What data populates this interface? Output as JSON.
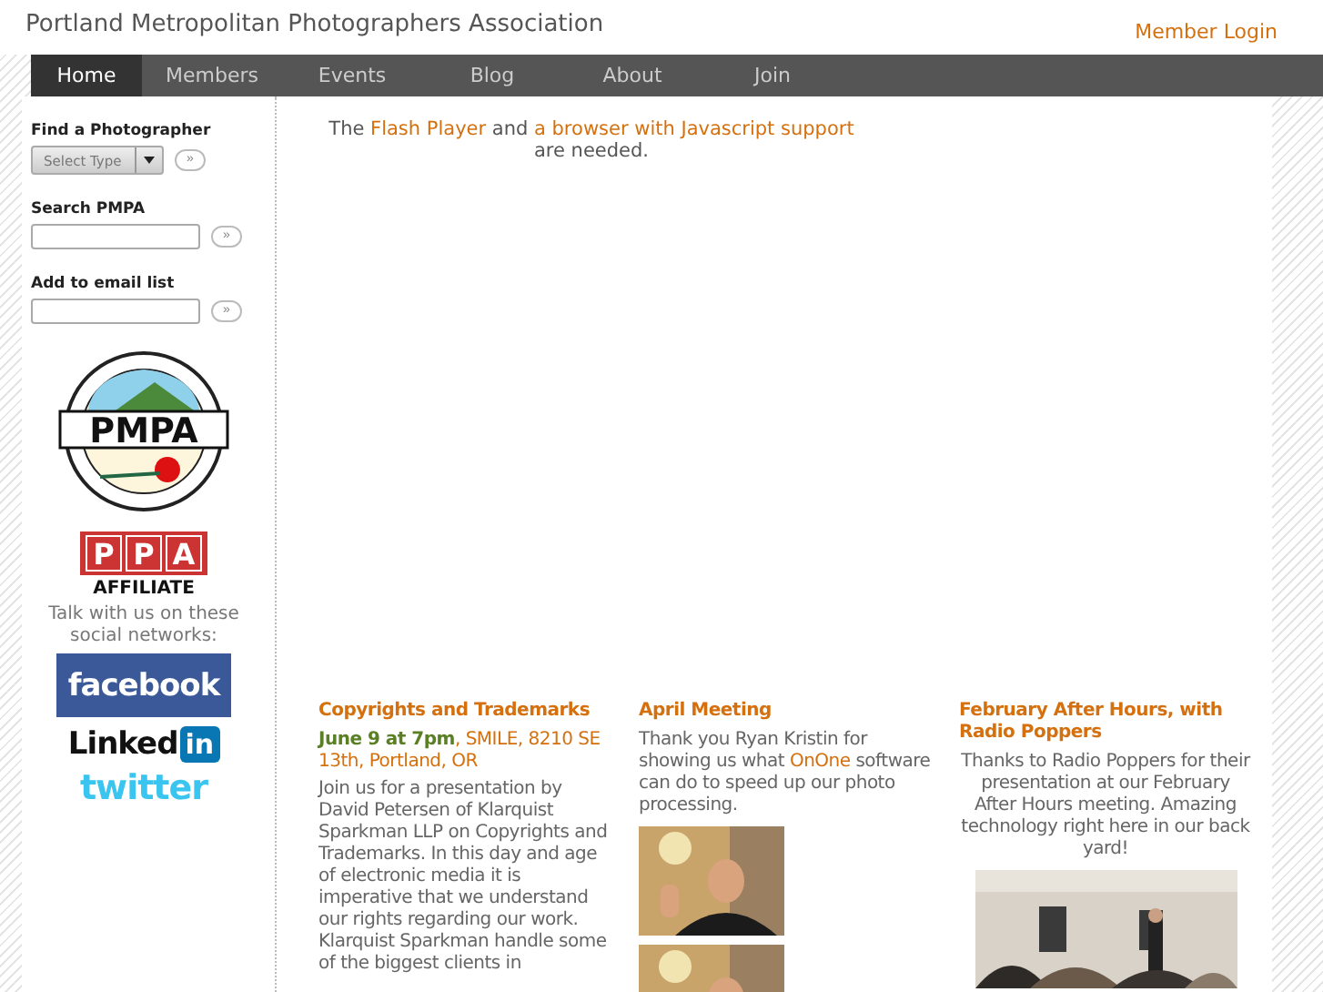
{
  "header": {
    "title": "Portland Metropolitan Photographers Association",
    "login": "Member Login"
  },
  "nav": [
    {
      "label": "Home",
      "selected": true
    },
    {
      "label": "Members",
      "selected": false
    },
    {
      "label": "Events",
      "selected": false
    },
    {
      "label": "Blog",
      "selected": false
    },
    {
      "label": "About",
      "selected": false
    },
    {
      "label": "Join",
      "selected": false
    }
  ],
  "sidebar": {
    "find": {
      "label": "Find a Photographer",
      "select": "Select Type",
      "go": "»"
    },
    "search": {
      "label": "Search PMPA",
      "go": "»"
    },
    "email": {
      "label": "Add to email list",
      "go": "»"
    },
    "logo": "PMPA",
    "ppa": [
      "P",
      "P",
      "A"
    ],
    "ppa_label": "AFFILIATE",
    "social_text": "Talk with us on these social networks:",
    "facebook": "facebook",
    "linkedin": [
      "Linked",
      "in"
    ],
    "twitter": "twitter"
  },
  "flash": {
    "before": "The ",
    "link1": "Flash Player",
    "mid": " and ",
    "link2": "a browser with Javascript support",
    "after": " are needed."
  },
  "news": [
    {
      "title": "Copyrights and Trademarks",
      "date": "June 9 at 7pm",
      "place": ", SMILE, 8210 SE 13th, Portland, OR",
      "body": [
        "Join us for a presentation by David Petersen of Klarquist Sparkman LLP on Copyrights and Trademarks. In this day and age of electronic media it is imperative that we understand our rights regarding our work. Klarquist Sparkman handle some of the biggest clients in"
      ]
    },
    {
      "title": "April Meeting",
      "body": [
        "Thank you Ryan Kristin for showing us what ",
        "OnOne",
        " software can do to speed up our photo processing."
      ],
      "pictures": [
        {
          "kind": "picture"
        },
        {
          "kind": "picture"
        }
      ]
    },
    {
      "title": "February After Hours, with Radio Poppers",
      "center": true,
      "body": [
        "Thanks to Radio Poppers for their presentation at our February After Hours meeting. Amazing technology right here in our back yard!"
      ],
      "pictures": [
        {
          "kind": "picture"
        }
      ]
    }
  ]
}
